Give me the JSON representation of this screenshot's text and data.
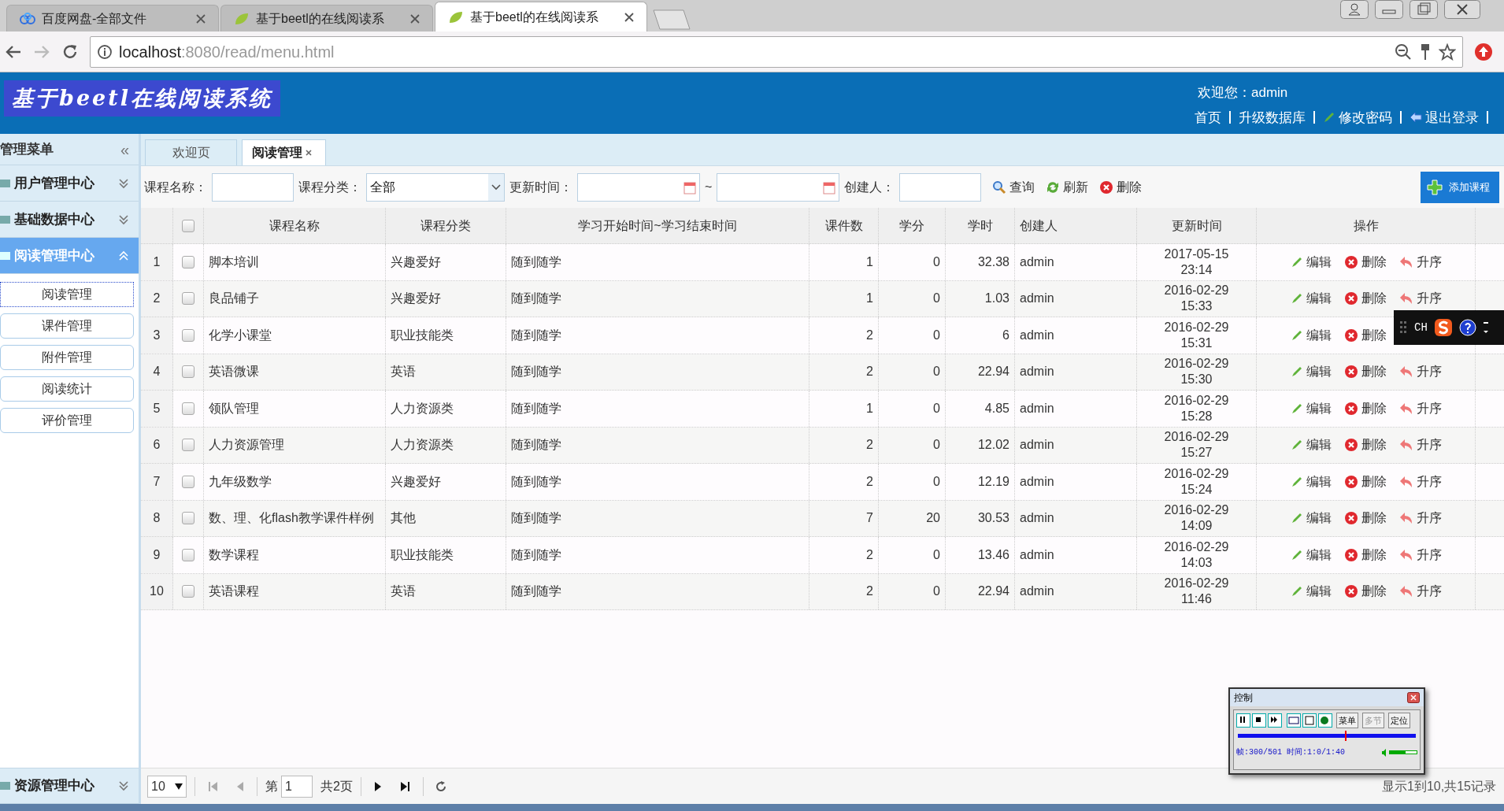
{
  "browser": {
    "tabs": [
      {
        "title": "百度网盘-全部文件",
        "kind": "cloud",
        "selected": false
      },
      {
        "title": "基于beetl的在线阅读系",
        "kind": "leaf",
        "selected": false
      },
      {
        "title": "基于beetl的在线阅读系",
        "kind": "leaf",
        "selected": true
      }
    ],
    "address": {
      "host": "localhost",
      "path": ":8080/read/menu.html"
    }
  },
  "header": {
    "logo": "基于beetl在线阅读系统",
    "welcome": "欢迎您：admin",
    "links": [
      {
        "label": "首页",
        "kind": "plain"
      },
      {
        "label": "升级数据库",
        "kind": "plain"
      },
      {
        "label": "修改密码",
        "kind": "pencil"
      },
      {
        "label": "退出登录",
        "kind": "exit"
      }
    ]
  },
  "sidebar": {
    "title": "管理菜单",
    "collapse": "«",
    "groups": [
      {
        "label": "用户管理中心",
        "expanded": false,
        "selected": false
      },
      {
        "label": "基础数据中心",
        "expanded": false,
        "selected": false
      },
      {
        "label": "阅读管理中心",
        "expanded": true,
        "selected": true,
        "children": [
          {
            "label": "阅读管理",
            "selected": true
          },
          {
            "label": "课件管理",
            "selected": false
          },
          {
            "label": "附件管理",
            "selected": false
          },
          {
            "label": "阅读统计",
            "selected": false
          },
          {
            "label": "评价管理",
            "selected": false
          }
        ]
      }
    ],
    "bottom_group": {
      "label": "资源管理中心",
      "expanded": false
    }
  },
  "content_tabs": [
    {
      "label": "欢迎页",
      "selected": false,
      "closable": false
    },
    {
      "label": "阅读管理",
      "selected": true,
      "closable": true
    }
  ],
  "filters": {
    "name_label": "课程名称：",
    "category_label": "课程分类：",
    "category_value": "全部",
    "time_label": "更新时间：",
    "range_sep": "~",
    "creator_label": "创建人：",
    "buttons": [
      {
        "label": "查询",
        "kind": "search"
      },
      {
        "label": "刷新",
        "kind": "refresh"
      },
      {
        "label": "删除",
        "kind": "delete"
      }
    ],
    "add_button": "添加课程"
  },
  "table": {
    "header_checked": false,
    "columns": [
      "课程名称",
      "课程分类",
      "学习开始时间~学习结束时间",
      "课件数",
      "学分",
      "学时",
      "创建人",
      "更新时间",
      "操作"
    ],
    "rows": [
      {
        "no": "1",
        "checked": false,
        "name": "脚本培训",
        "category": "兴趣爱好",
        "period": "随到随学",
        "files": "1",
        "credit": "0",
        "hours": "32.38",
        "creator": "admin",
        "date": "2017-05-15",
        "time": "23:14",
        "actions": [
          {
            "kind": "edit",
            "label": "编辑"
          },
          {
            "kind": "delete",
            "label": "删除"
          },
          {
            "kind": "up",
            "label": "升序"
          }
        ]
      },
      {
        "no": "2",
        "checked": false,
        "name": "良品铺子",
        "category": "兴趣爱好",
        "period": "随到随学",
        "files": "1",
        "credit": "0",
        "hours": "1.03",
        "creator": "admin",
        "date": "2016-02-29",
        "time": "15:33",
        "actions": [
          {
            "kind": "edit",
            "label": "编辑"
          },
          {
            "kind": "delete",
            "label": "删除"
          },
          {
            "kind": "up",
            "label": "升序"
          }
        ]
      },
      {
        "no": "3",
        "checked": false,
        "name": "化学小课堂",
        "category": "职业技能类",
        "period": "随到随学",
        "files": "2",
        "credit": "0",
        "hours": "6",
        "creator": "admin",
        "date": "2016-02-29",
        "time": "15:31",
        "actions": [
          {
            "kind": "edit",
            "label": "编辑"
          },
          {
            "kind": "delete",
            "label": "删除"
          }
        ]
      },
      {
        "no": "4",
        "checked": false,
        "name": "英语微课",
        "category": "英语",
        "period": "随到随学",
        "files": "2",
        "credit": "0",
        "hours": "22.94",
        "creator": "admin",
        "date": "2016-02-29",
        "time": "15:30",
        "actions": [
          {
            "kind": "edit",
            "label": "编辑"
          },
          {
            "kind": "delete",
            "label": "删除"
          },
          {
            "kind": "up",
            "label": "升序"
          }
        ]
      },
      {
        "no": "5",
        "checked": false,
        "name": "领队管理",
        "category": "人力资源类",
        "period": "随到随学",
        "files": "1",
        "credit": "0",
        "hours": "4.85",
        "creator": "admin",
        "date": "2016-02-29",
        "time": "15:28",
        "actions": [
          {
            "kind": "edit",
            "label": "编辑"
          },
          {
            "kind": "delete",
            "label": "删除"
          },
          {
            "kind": "up",
            "label": "升序"
          }
        ]
      },
      {
        "no": "6",
        "checked": false,
        "name": "人力资源管理",
        "category": "人力资源类",
        "period": "随到随学",
        "files": "2",
        "credit": "0",
        "hours": "12.02",
        "creator": "admin",
        "date": "2016-02-29",
        "time": "15:27",
        "actions": [
          {
            "kind": "edit",
            "label": "编辑"
          },
          {
            "kind": "delete",
            "label": "删除"
          },
          {
            "kind": "up",
            "label": "升序"
          }
        ]
      },
      {
        "no": "7",
        "checked": false,
        "name": "九年级数学",
        "category": "兴趣爱好",
        "period": "随到随学",
        "files": "2",
        "credit": "0",
        "hours": "12.19",
        "creator": "admin",
        "date": "2016-02-29",
        "time": "15:24",
        "actions": [
          {
            "kind": "edit",
            "label": "编辑"
          },
          {
            "kind": "delete",
            "label": "删除"
          },
          {
            "kind": "up",
            "label": "升序"
          }
        ]
      },
      {
        "no": "8",
        "checked": false,
        "name": "数、理、化flash教学课件样例",
        "category": "其他",
        "period": "随到随学",
        "files": "7",
        "credit": "20",
        "hours": "30.53",
        "creator": "admin",
        "date": "2016-02-29",
        "time": "14:09",
        "actions": [
          {
            "kind": "edit",
            "label": "编辑"
          },
          {
            "kind": "delete",
            "label": "删除"
          },
          {
            "kind": "up",
            "label": "升序"
          }
        ]
      },
      {
        "no": "9",
        "checked": false,
        "name": "数学课程",
        "category": "职业技能类",
        "period": "随到随学",
        "files": "2",
        "credit": "0",
        "hours": "13.46",
        "creator": "admin",
        "date": "2016-02-29",
        "time": "14:03",
        "actions": [
          {
            "kind": "edit",
            "label": "编辑"
          },
          {
            "kind": "delete",
            "label": "删除"
          },
          {
            "kind": "up",
            "label": "升序"
          }
        ]
      },
      {
        "no": "10",
        "checked": false,
        "name": "英语课程",
        "category": "英语",
        "period": "随到随学",
        "files": "2",
        "credit": "0",
        "hours": "22.94",
        "creator": "admin",
        "date": "2016-02-29",
        "time": "11:46",
        "actions": [
          {
            "kind": "edit",
            "label": "编辑"
          },
          {
            "kind": "delete",
            "label": "删除"
          },
          {
            "kind": "up",
            "label": "升序"
          }
        ]
      }
    ]
  },
  "pager": {
    "page_size": "10",
    "page_prefix": "第",
    "page": "1",
    "page_suffix": "共2页",
    "summary": "显示1到10,共15记录"
  },
  "ime_bar": {
    "label": "CH"
  },
  "recorder": {
    "title": "控制",
    "buttons": [
      {
        "label": "菜单",
        "disabled": false
      },
      {
        "label": "多节",
        "disabled": true
      },
      {
        "label": "定位",
        "disabled": false
      }
    ],
    "position": {
      "level": 0.6
    },
    "volume": {
      "level": 0.6
    },
    "status": "帧:300/501 时间:1:0/1:40"
  }
}
